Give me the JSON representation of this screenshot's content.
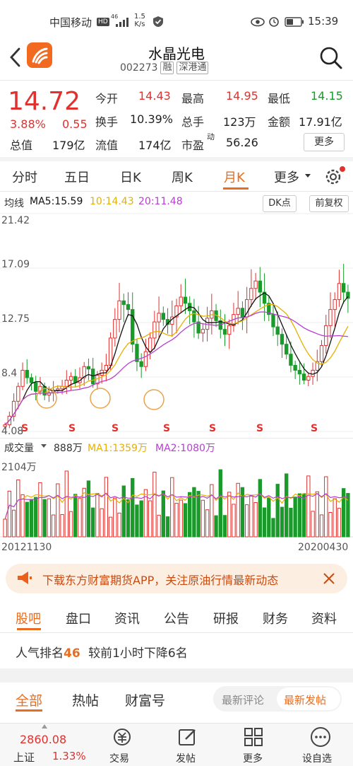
{
  "status_bar": {
    "carrier": "中国移动",
    "hd": "HD",
    "signal": "46",
    "speed_value": "1.5",
    "speed_unit": "K/s",
    "time": "15:39"
  },
  "header": {
    "title": "水晶光电",
    "code": "002273",
    "tag_margin": "融",
    "tag_connect": "深港通"
  },
  "quote": {
    "price": "14.72",
    "change_pct": "3.88%",
    "change_amt": "0.55",
    "open_label": "今开",
    "open_value": "14.43",
    "high_label": "最高",
    "high_value": "14.95",
    "low_label": "最低",
    "low_value": "14.15",
    "turnover_label": "换手",
    "turnover_value": "10.39%",
    "volume_label": "总手",
    "volume_value": "123万",
    "amount_label": "金额",
    "amount_value": "17.91亿",
    "mcap_label": "总值",
    "mcap_value": "179亿",
    "float_label": "流值",
    "float_value": "174亿",
    "pe_label": "市盈",
    "pe_sup": "动",
    "pe_value": "56.26",
    "more_label": "更多"
  },
  "period_tabs": [
    "分时",
    "五日",
    "日K",
    "周K",
    "月K",
    "更多"
  ],
  "period_active": "月K",
  "kline": {
    "indicator_label": "均线",
    "ma5": "MA5:15.59",
    "ma10": "10:14.43",
    "ma20": "20:11.48",
    "dk_label": "DK点",
    "adjust_label": "前复权",
    "y_ticks": [
      "21.42",
      "17.09",
      "12.75",
      "8.4",
      "4.08"
    ],
    "s_marker": "S"
  },
  "volume": {
    "label": "成交量",
    "current": "888万",
    "ma1": "MA1:1359万",
    "ma2": "MA2:1080万",
    "y_top": "2104万",
    "date_start": "20121130",
    "date_end": "20200430"
  },
  "banner": {
    "text": "下载东方财富期货APP，关注原油行情最新动态"
  },
  "section_tabs": [
    "股吧",
    "盘口",
    "资讯",
    "公告",
    "研报",
    "财务",
    "资料"
  ],
  "section_active": "股吧",
  "popularity": {
    "prefix": "人气排名",
    "rank": "46",
    "suffix": "较前1小时下降6名"
  },
  "forum_tabs": [
    "全部",
    "热帖",
    "财富号"
  ],
  "forum_sort": [
    "最新评论",
    "最新发帖"
  ],
  "bottom": {
    "index_value": "2860.08",
    "index_name": "上证",
    "index_change": "1.33%",
    "nav": [
      "交易",
      "发帖",
      "更多",
      "设自选"
    ]
  },
  "colors": {
    "up": "#e0312e",
    "down": "#1a9a2a",
    "accent": "#e96d1f",
    "ma5": "#111111",
    "ma10": "#e6b000",
    "ma20": "#b53fd0"
  }
}
